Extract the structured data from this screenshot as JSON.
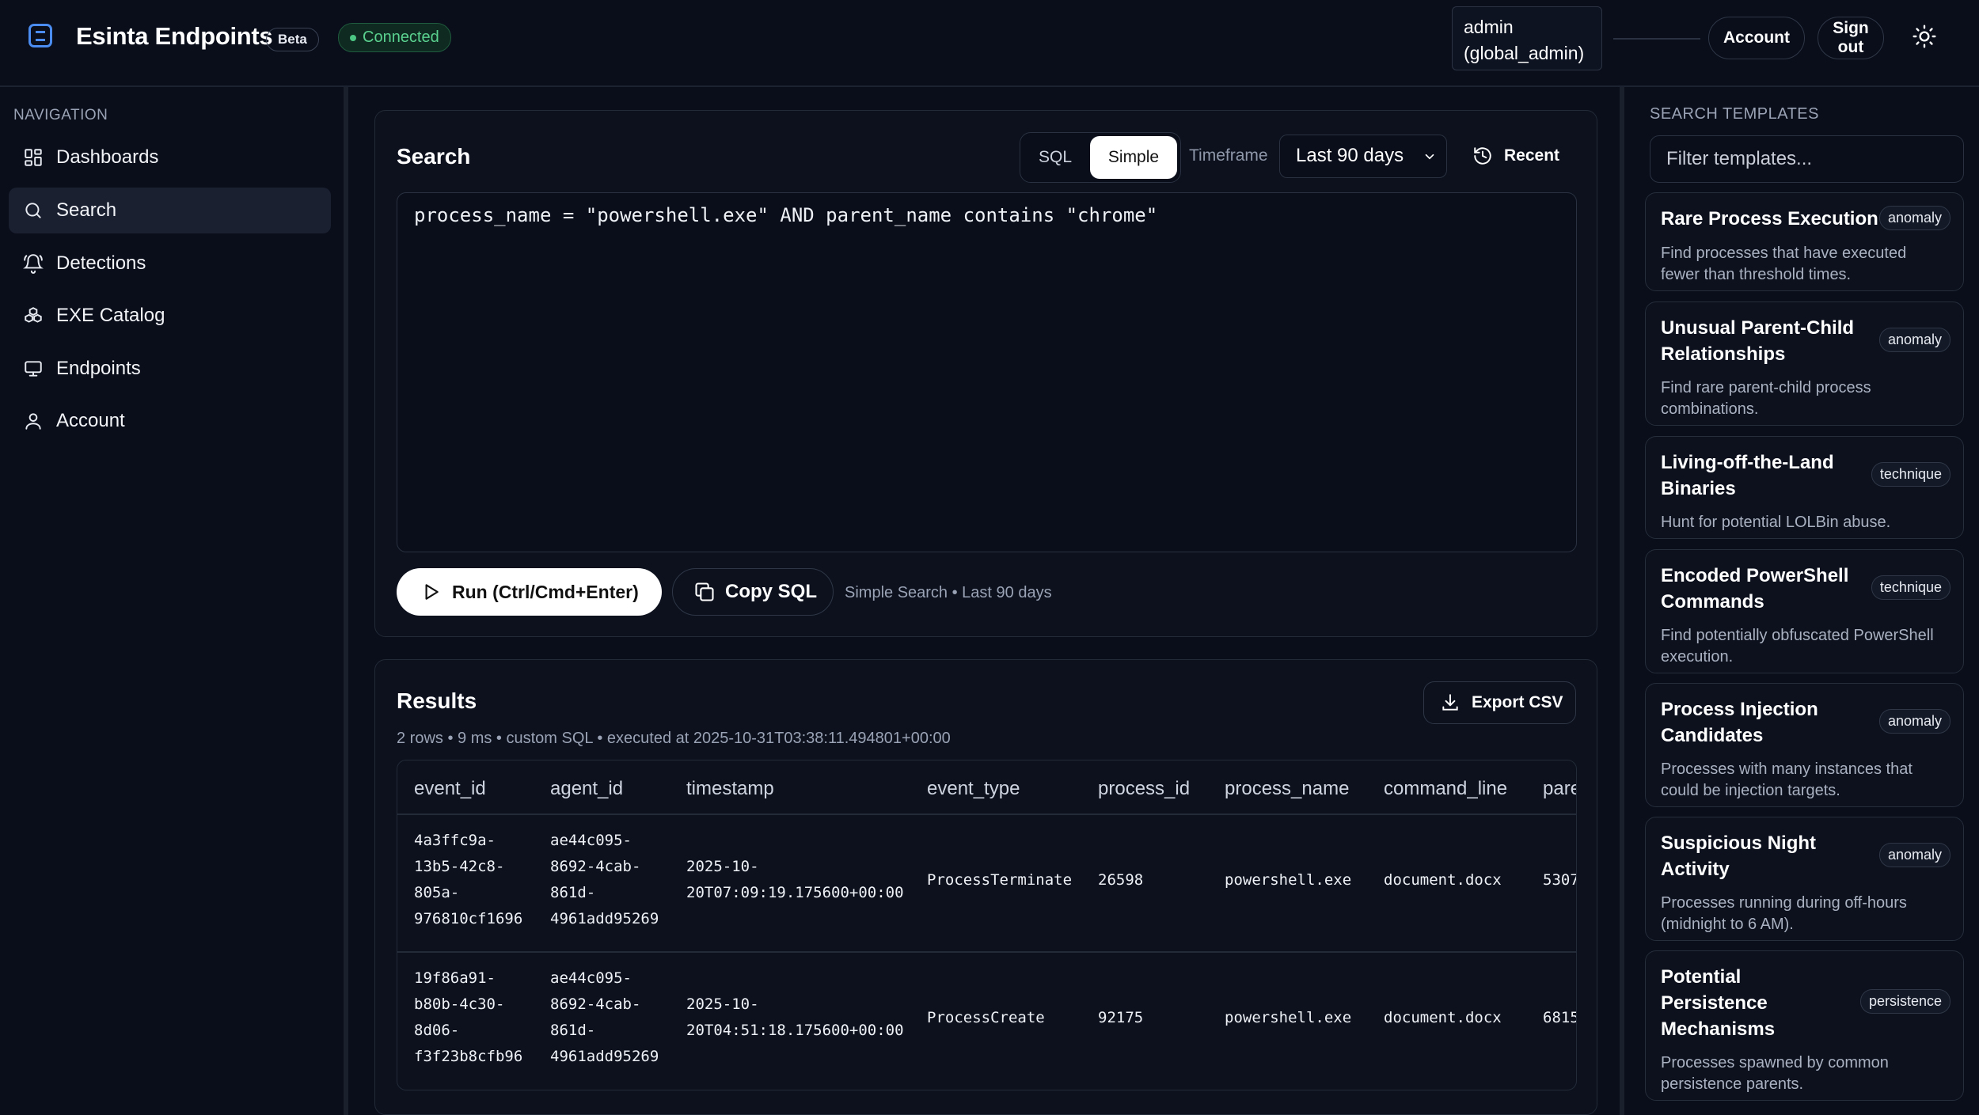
{
  "header": {
    "app_title": "Esinta Endpoints",
    "beta_label": "Beta",
    "status_label": "Connected",
    "user_line1": "admin",
    "user_line2": "(global_admin)",
    "account_label": "Account",
    "signout_line1": "Sign",
    "signout_line2": "out"
  },
  "sidebar": {
    "heading": "NAVIGATION",
    "items": [
      {
        "label": "Dashboards",
        "icon": "dashboard-icon"
      },
      {
        "label": "Search",
        "icon": "search-icon",
        "active": true
      },
      {
        "label": "Detections",
        "icon": "bell-icon"
      },
      {
        "label": "EXE Catalog",
        "icon": "boxes-icon"
      },
      {
        "label": "Endpoints",
        "icon": "monitor-icon"
      },
      {
        "label": "Account",
        "icon": "user-icon"
      }
    ]
  },
  "search": {
    "title": "Search",
    "mode_sql": "SQL",
    "mode_simple": "Simple",
    "mode_selected": "Simple",
    "timeframe_label": "Timeframe",
    "timeframe_value": "Last 90 days",
    "recent_label": "Recent",
    "query": "process_name = \"powershell.exe\" AND parent_name contains \"chrome\"",
    "run_label": "Run (Ctrl/Cmd+Enter)",
    "copy_label": "Copy SQL",
    "meta": "Simple Search • Last 90 days"
  },
  "results": {
    "title": "Results",
    "export_label": "Export CSV",
    "meta": "2 rows • 9 ms • custom SQL • executed at 2025-10-31T03:38:11.494801+00:00",
    "columns": [
      "event_id",
      "agent_id",
      "timestamp",
      "event_type",
      "process_id",
      "process_name",
      "command_line",
      "pare"
    ],
    "rows": [
      {
        "event_id": "4a3ffc9a-\n13b5-42c8-\n805a-\n976810cf1696",
        "agent_id": "ae44c095-\n8692-4cab-\n861d-\n4961add95269",
        "timestamp": "2025-10-\n20T07:09:19.175600+00:00",
        "event_type": "ProcessTerminate",
        "process_id": "26598",
        "process_name": "powershell.exe",
        "command_line": "document.docx",
        "parent": "5307"
      },
      {
        "event_id": "19f86a91-\nb80b-4c30-\n8d06-\nf3f23b8cfb96",
        "agent_id": "ae44c095-\n8692-4cab-\n861d-\n4961add95269",
        "timestamp": "2025-10-\n20T04:51:18.175600+00:00",
        "event_type": "ProcessCreate",
        "process_id": "92175",
        "process_name": "powershell.exe",
        "command_line": "document.docx",
        "parent": "6815"
      }
    ]
  },
  "templates": {
    "heading": "SEARCH TEMPLATES",
    "filter_placeholder": "Filter templates...",
    "items": [
      {
        "title": "Rare Process Execution",
        "badge": "anomaly",
        "desc": "Find processes that have executed fewer than threshold times."
      },
      {
        "title": "Unusual Parent-Child Relationships",
        "badge": "anomaly",
        "desc": "Find rare parent-child process combinations."
      },
      {
        "title": "Living-off-the-Land Binaries",
        "badge": "technique",
        "desc": "Hunt for potential LOLBin abuse."
      },
      {
        "title": "Encoded PowerShell Commands",
        "badge": "technique",
        "desc": "Find potentially obfuscated PowerShell execution."
      },
      {
        "title": "Process Injection Candidates",
        "badge": "anomaly",
        "desc": "Processes with many instances that could be injection targets."
      },
      {
        "title": "Suspicious Night Activity",
        "badge": "anomaly",
        "desc": "Processes running during off-hours (midnight to 6 AM)."
      },
      {
        "title": "Potential Persistence Mechanisms",
        "badge": "persistence",
        "desc": "Processes spawned by common persistence parents."
      }
    ]
  }
}
